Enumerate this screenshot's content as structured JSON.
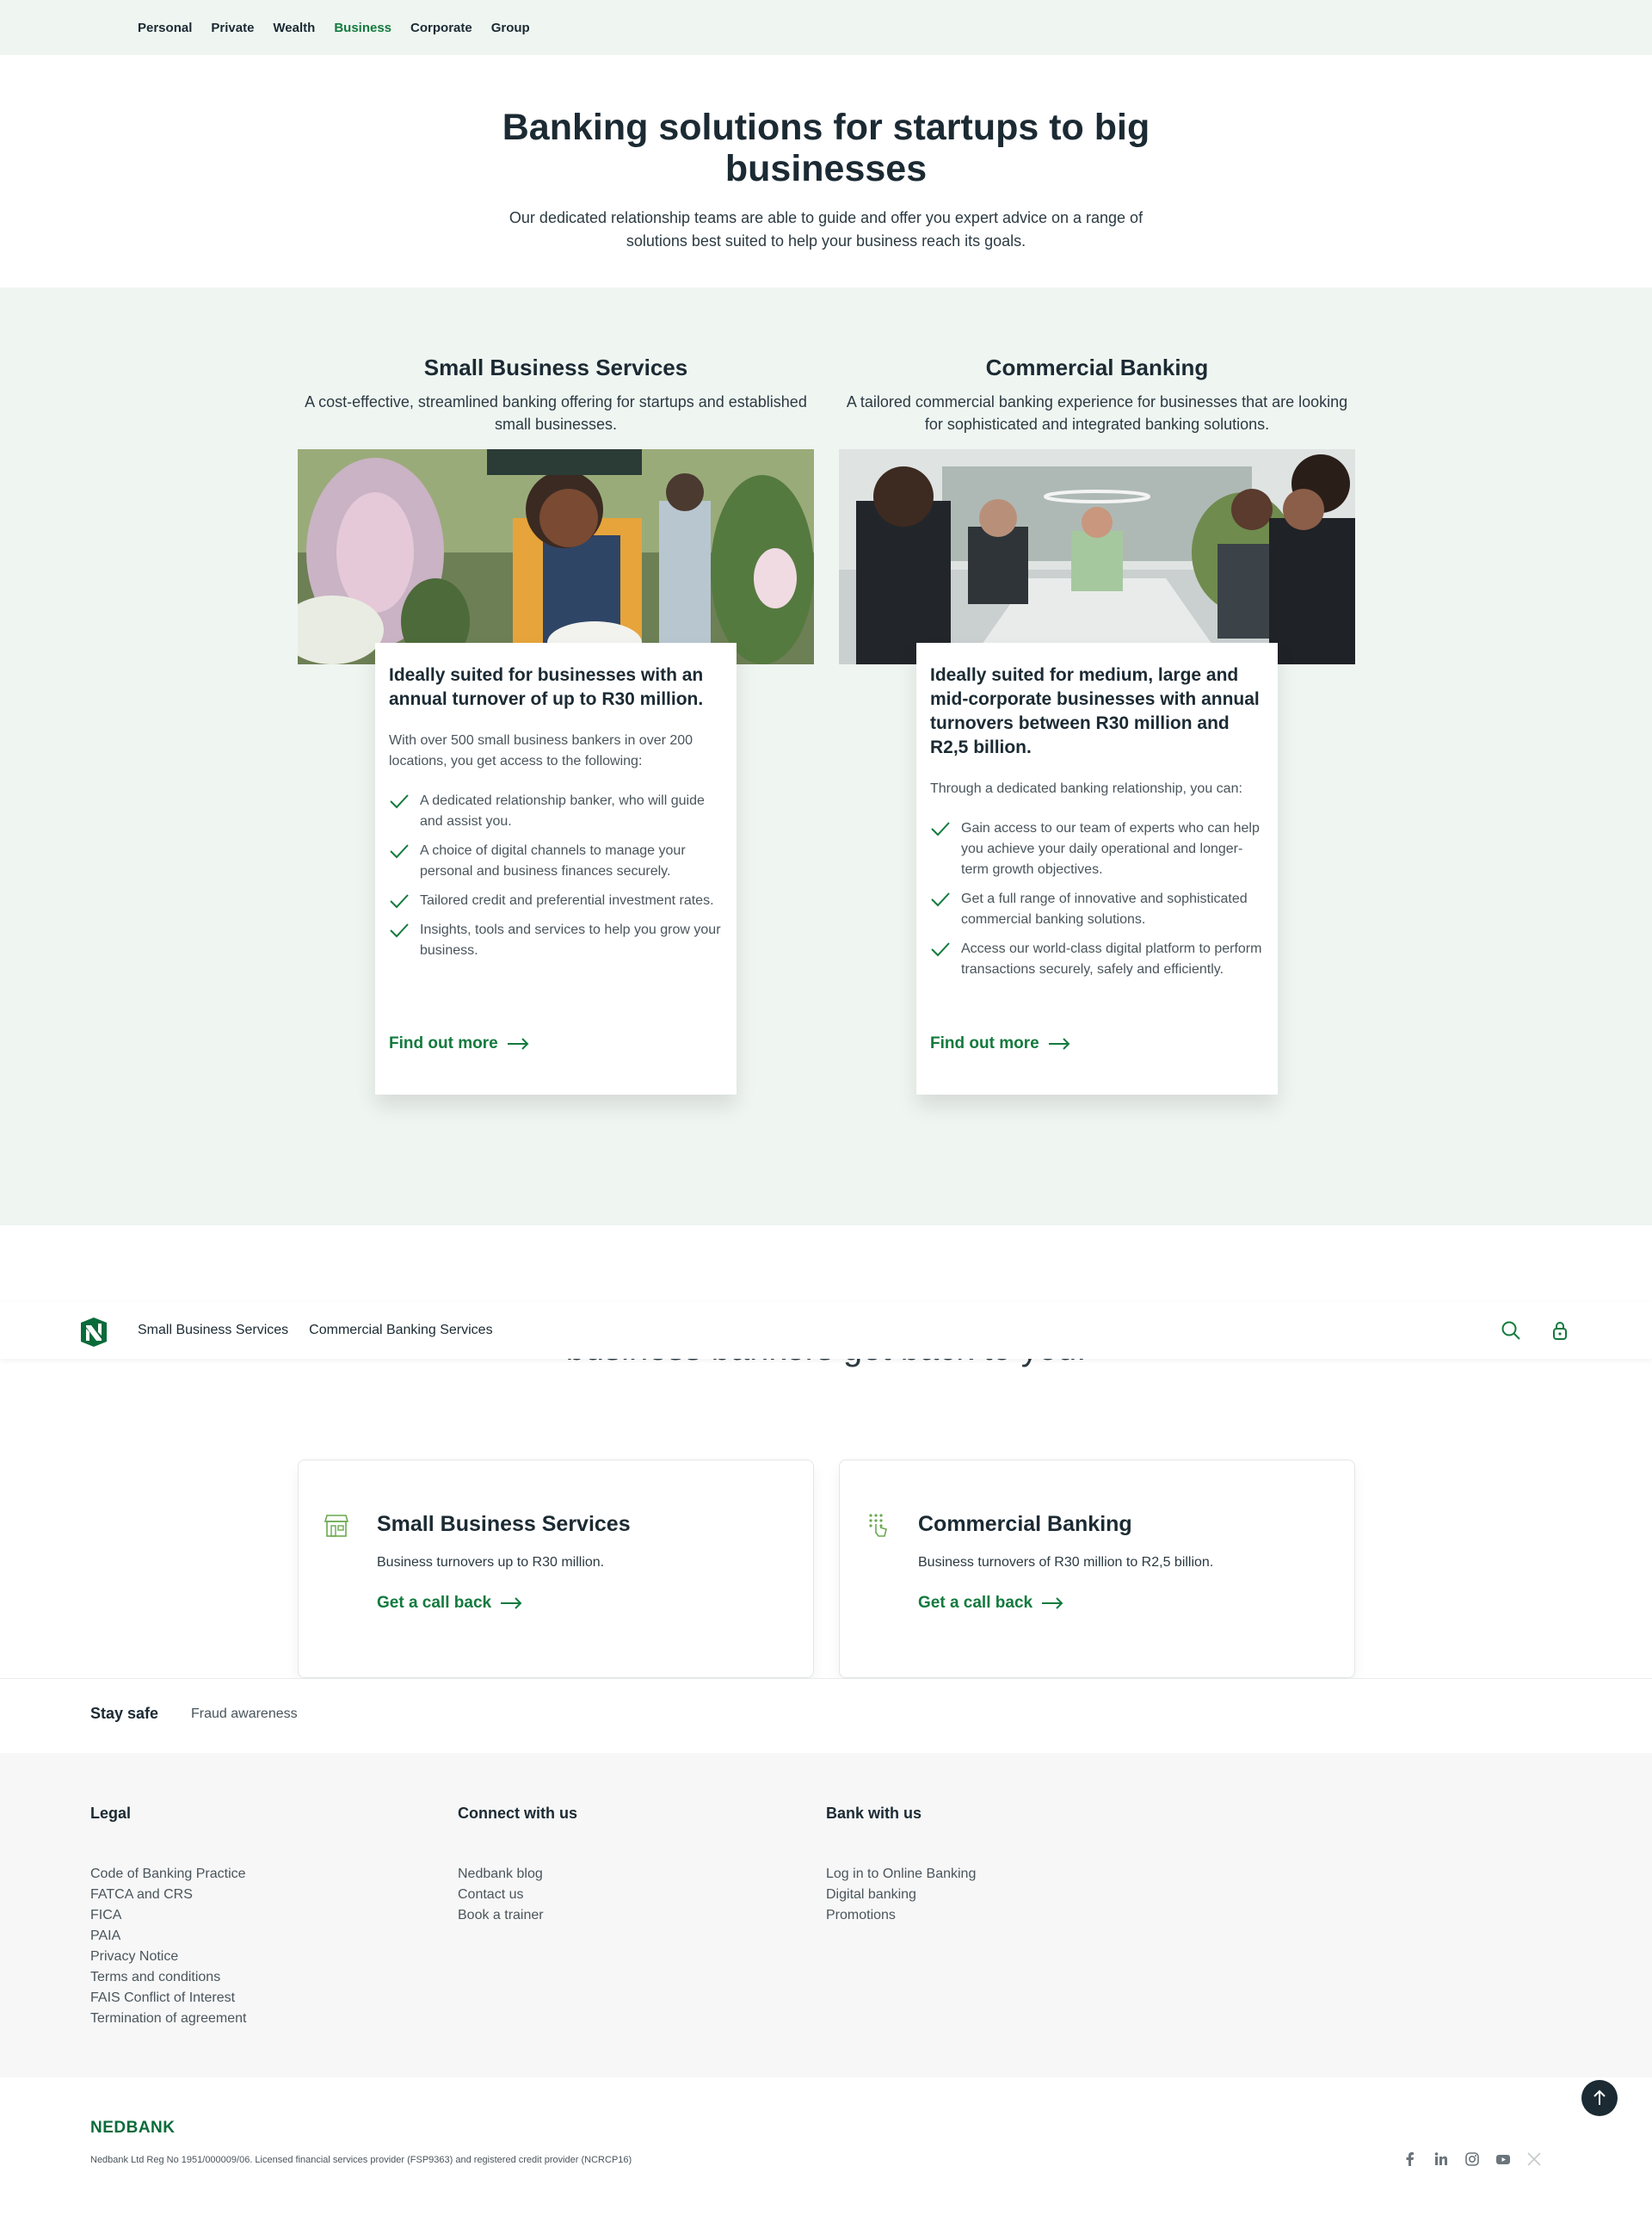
{
  "topnav": {
    "items": [
      "Personal",
      "Private",
      "Wealth",
      "Business",
      "Corporate",
      "Group"
    ],
    "active": "Business"
  },
  "hero": {
    "title": "Banking solutions for startups to big businesses",
    "subtitle": "Our dedicated relationship teams are able to guide and offer you expert advice on a range of solutions best suited to help your business reach its goals."
  },
  "offerings": [
    {
      "title": "Small Business Services",
      "subtitle": "A cost-effective, streamlined banking offering for startups and established small businesses.",
      "card_heading": "Ideally suited for businesses with an annual turnover of up to R30 million.",
      "intro": "With over 500 small business bankers in over 200 locations, you get access to the following:",
      "benefits": [
        "A dedicated relationship banker, who will guide and assist you.",
        "A choice of digital channels to manage your personal and business finances securely.",
        "Tailored credit and preferential investment rates.",
        "Insights, tools and services to help you grow your business."
      ],
      "cta": "Find out more"
    },
    {
      "title": "Commercial Banking",
      "subtitle": "A tailored commercial banking experience for businesses that are looking for sophisticated and integrated banking solutions.",
      "card_heading": "Ideally suited for medium, large and mid-corporate businesses with annual turnovers between R30 million and R2,5 billion.",
      "intro": "Through a dedicated banking relationship, you can:",
      "benefits": [
        "Gain access to our team of experts who can help you achieve your daily operational and longer-term growth objectives.",
        "Get a full range of innovative and sophisticated commercial banking solutions.",
        "Access our world-class digital platform to perform transactions securely, safely and efficiently."
      ],
      "cta": "Find out more"
    }
  ],
  "subnav": {
    "links": [
      "Small Business Services",
      "Commercial Banking Services"
    ],
    "icons": [
      "search-icon",
      "lock-icon"
    ]
  },
  "callback_partial_heading": "business bankers get back to you.",
  "callback_cards": [
    {
      "title": "Small Business Services",
      "desc": "Business turnovers up to R30 million.",
      "cta": "Get a call back",
      "icon": "store-icon"
    },
    {
      "title": "Commercial Banking",
      "desc": "Business turnovers of R30 million to R2,5 billion.",
      "cta": "Get a call back",
      "icon": "touch-keypad-icon"
    }
  ],
  "stay_safe": {
    "title": "Stay safe",
    "link": "Fraud awareness"
  },
  "footer": {
    "columns": [
      {
        "title": "Legal",
        "links": [
          "Code of Banking Practice",
          "FATCA and CRS",
          "FICA",
          "PAIA",
          "Privacy Notice",
          "Terms and conditions",
          "FAIS Conflict of Interest",
          "Termination of agreement"
        ]
      },
      {
        "title": "Connect with us",
        "links": [
          "Nedbank blog",
          "Contact us",
          "Book a trainer"
        ]
      },
      {
        "title": "Bank with us",
        "links": [
          "Log in to Online Banking",
          "Digital banking",
          "Promotions"
        ]
      }
    ],
    "brand": "NEDBANK",
    "legal": "Nedbank Ltd Reg No 1951/000009/06. Licensed financial services provider (FSP9363) and registered credit provider (NCRCP16)",
    "social_icons": [
      "facebook-icon",
      "linkedin-icon",
      "instagram-icon",
      "youtube-icon",
      "x-icon"
    ]
  },
  "colors": {
    "brand_green": "#137a3e",
    "pale_green": "#eff5f1",
    "dark": "#1b2a33"
  }
}
